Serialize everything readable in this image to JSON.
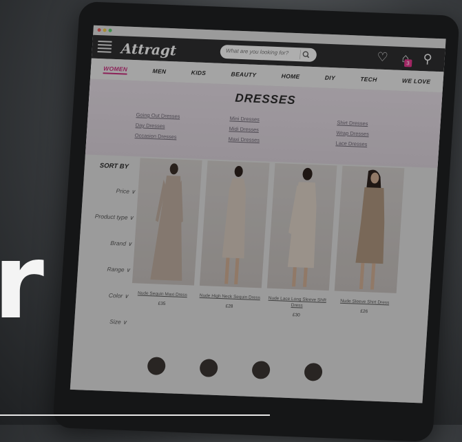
{
  "overlay": {
    "big_letter": "r"
  },
  "site": {
    "logo": "Attragt",
    "cart_count": "3",
    "search": {
      "placeholder": "What are you looking for?"
    }
  },
  "nav": [
    "WOMEN",
    "MEN",
    "KIDS",
    "BEAUTY",
    "HOME",
    "DIY",
    "TECH",
    "WE LOVE"
  ],
  "page": {
    "title": "DRESSES",
    "subcategories": [
      [
        "Going Out Dresses",
        "Day Dresses",
        "Occasion Dresses"
      ],
      [
        "Mini Dresses",
        "Midi Dresses",
        "Maxi Dresses"
      ],
      [
        "Shirt Dresses",
        "Wrap Dresses",
        "Lace Dresses"
      ]
    ]
  },
  "sidebar": {
    "sort_title": "SORT BY",
    "filters": [
      "Price ∨",
      "Product type ∨",
      "Brand ∨",
      "Range ∨",
      "Color ∨",
      "Size ∨"
    ]
  },
  "products": [
    {
      "name": "Nude Sequin Maxi Dress",
      "price": "£35"
    },
    {
      "name": "Nude High Neck Sequin Dress",
      "price": "£28"
    },
    {
      "name": "Nude Lace Long Sleeve Shift Dress",
      "price": "£30"
    },
    {
      "name": "Nude Sleeve Shirt Dress",
      "price": "£26"
    }
  ],
  "colors": {
    "accent": "#c22f7a",
    "badge": "#e0358a",
    "topbar": "#2d2d2f",
    "dot_red": "#e25b5b",
    "dot_yellow": "#e8c24a",
    "dot_green": "#5bc46b"
  }
}
